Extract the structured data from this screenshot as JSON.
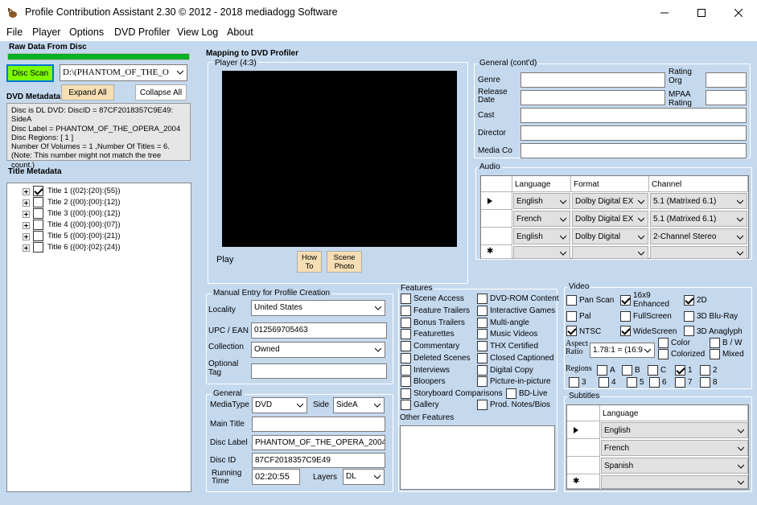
{
  "window": {
    "title": "Profile Contribution Assistant 2.30 © 2012 - 2018 mediadogg Software"
  },
  "menu": [
    "File",
    "Player",
    "Options",
    "DVD Profiler",
    "View Log",
    "About"
  ],
  "left": {
    "raw_label": "Raw Data From Disc",
    "disc_scan": "Disc Scan",
    "drive": "D:\\(PHANTOM_OF_THE_O",
    "expand_all": "Expand All",
    "collapse_all": "Collapse All",
    "dvd_metadata_label": "DVD Metadata",
    "metadata_lines": [
      "Disc is DL DVD: DiscID = 87CF2018357C9E49:",
      "SideA",
      "Disc Label = PHANTOM_OF_THE_OPERA_2004",
      "Disc Regions: [ 1 ]",
      "Number Of Volumes = 1 ,Number Of Titles = 6.",
      "(Note: This number might not match the tree count.)"
    ],
    "title_metadata_label": "Title Metadata",
    "titles": [
      {
        "label": "Title 1 ({02}:{20}:{55})",
        "checked": true
      },
      {
        "label": "Title 2 ({00}:{00}:{12})",
        "checked": false
      },
      {
        "label": "Title 3 ({00}:{00}:{12})",
        "checked": false
      },
      {
        "label": "Title 4 ({00}:{00}:{07})",
        "checked": false
      },
      {
        "label": "Title 5 ({00}:{00}:{21})",
        "checked": false
      },
      {
        "label": "Title 6 ({00}:{02}:{24})",
        "checked": false
      }
    ]
  },
  "mapping": {
    "title": "Mapping to DVD Profiler",
    "player_label": "Player (4:3)",
    "play": "Play",
    "how_to": "How To",
    "scene_photo": "Scene Photo"
  },
  "general_cont": {
    "title": "General (cont'd)",
    "genre": "Genre",
    "rating_org": "Rating Org",
    "release_date": "Release Date",
    "mpaa_rating": "MPAA Rating",
    "cast": "Cast",
    "director": "Director",
    "media_co": "Media Co"
  },
  "audio": {
    "title": "Audio",
    "headers": [
      "Language",
      "Format",
      "Channel"
    ],
    "rows": [
      [
        "English",
        "Dolby Digital EX",
        "5.1 (Matrixed 6.1)"
      ],
      [
        "French",
        "Dolby Digital EX",
        "5.1 (Matrixed 6.1)"
      ],
      [
        "English",
        "Dolby Digital",
        "2-Channel Stereo"
      ]
    ]
  },
  "manual": {
    "title": "Manual Entry for Profile Creation",
    "locality_label": "Locality",
    "locality": "United States",
    "upc_label": "UPC / EAN",
    "upc": "012569705463",
    "collection_label": "Collection",
    "collection": "Owned",
    "optional_tag_label": "Optional Tag"
  },
  "general": {
    "title": "General",
    "mediatype_label": "MediaType",
    "mediatype": "DVD",
    "side_label": "Side",
    "side": "SideA",
    "main_title_label": "Main Title",
    "disc_label_label": "Disc Label",
    "disc_label": "PHANTOM_OF_THE_OPERA_2004",
    "disc_id_label": "Disc ID",
    "disc_id": "87CF2018357C9E49",
    "running_time_label": "Running Time",
    "running_time": "02:20:55",
    "layers_label": "Layers",
    "layers": "DL"
  },
  "features": {
    "title": "Features",
    "col1": [
      "Scene Access",
      "Feature Trailers",
      "Bonus Trailers",
      "Featurettes",
      "Commentary",
      "Deleted Scenes",
      "Interviews",
      "Bloopers",
      "Storyboard Comparisons",
      "Gallery"
    ],
    "col2": [
      "DVD-ROM Content",
      "Interactive Games",
      "Multi-angle",
      "Music Videos",
      "THX Certified",
      "Closed Captioned",
      "Digital Copy",
      "Picture-in-picture",
      "BD-Live",
      "Prod. Notes/Bios"
    ],
    "other": "Other Features"
  },
  "video": {
    "title": "Video",
    "pan_scan": "Pan Scan",
    "enhanced": "16x9 Enhanced",
    "two_d": "2D",
    "pal": "Pal",
    "fullscreen": "FullScreen",
    "bluray3d": "3D Blu-Ray",
    "ntsc": "NTSC",
    "widescreen": "WideScreen",
    "anaglyph": "3D Anaglyph",
    "aspect_label": "Aspect Ratio",
    "aspect": "1.78:1 = (16:9",
    "color": "Color",
    "bw": "B / W",
    "colorized": "Colorized",
    "mixed": "Mixed",
    "regions_label": "Regions",
    "regions": [
      "A",
      "B",
      "C",
      "1",
      "2",
      "3",
      "4",
      "5",
      "6",
      "7",
      "8"
    ]
  },
  "subtitles": {
    "title": "Subtitles",
    "header": "Language",
    "rows": [
      "English",
      "French",
      "Spanish"
    ]
  }
}
